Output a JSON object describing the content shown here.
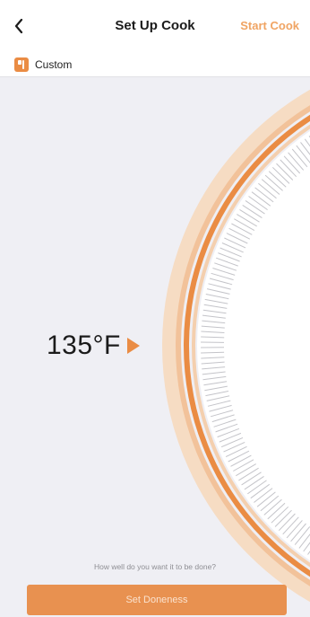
{
  "header": {
    "title": "Set Up Cook",
    "start_label": "Start Cook",
    "back_icon": "chevron-left-icon"
  },
  "profile": {
    "label": "Custom",
    "icon": "probe-icon"
  },
  "dial": {
    "temperature": "135°F",
    "temperature_value": 135,
    "unit": "°F",
    "pointer_icon": "triangle-right-icon"
  },
  "footer": {
    "prompt": "How well do you want it to be done?",
    "button_label": "Set Doneness"
  },
  "colors": {
    "accent": "#ea8c44",
    "accent_light": "#f0a463",
    "ring_pale": "#f6dcc3",
    "background": "#efeff4",
    "tick": "#c4c4c9"
  }
}
